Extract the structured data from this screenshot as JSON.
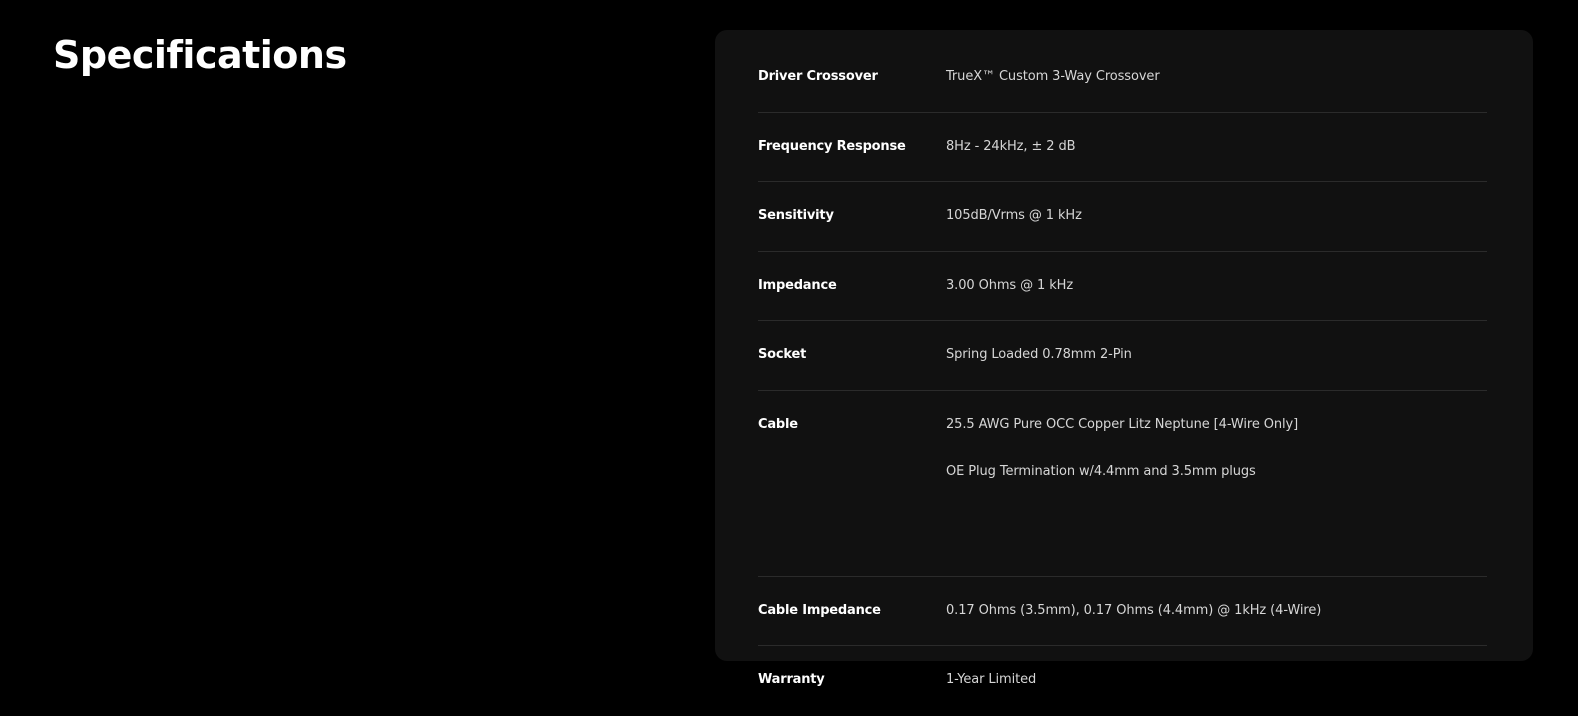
{
  "page": {
    "title": "Specifications"
  },
  "specs": [
    {
      "label": "Driver Crossover",
      "values": [
        "TrueX™ Custom 3-Way Crossover"
      ]
    },
    {
      "label": "Frequency Response",
      "values": [
        "8Hz - 24kHz, ± 2 dB"
      ]
    },
    {
      "label": "Sensitivity",
      "values": [
        "105dB/Vrms @ 1 kHz"
      ]
    },
    {
      "label": "Impedance",
      "values": [
        "3.00 Ohms @ 1 kHz"
      ]
    },
    {
      "label": "Socket",
      "values": [
        "Spring Loaded 0.78mm 2-Pin"
      ]
    },
    {
      "label": "Cable",
      "values": [
        "25.5 AWG Pure OCC Copper Litz Neptune [4-Wire Only]",
        "OE Plug Termination w/4.4mm and 3.5mm plugs"
      ]
    },
    {
      "label": "Cable Impedance",
      "values": [
        "0.17 Ohms (3.5mm), 0.17 Ohms (4.4mm) @ 1kHz (4-Wire)"
      ]
    },
    {
      "label": "Warranty",
      "values": [
        "1-Year Limited"
      ]
    }
  ],
  "colors": {
    "background": "#000000",
    "card": "#111111",
    "divider": "#2b2b2b",
    "label": "#ffffff",
    "value": "#d6d6d6"
  }
}
